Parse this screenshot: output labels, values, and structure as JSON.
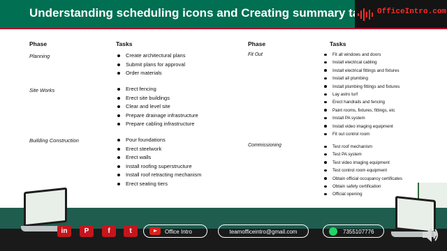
{
  "header": {
    "title": "Understanding scheduling icons and Creating summary task",
    "logo_text": "OfficeIntro.com"
  },
  "left_table": {
    "phase_header": "Phase",
    "tasks_header": "Tasks",
    "rows": [
      {
        "phase": "Planning",
        "tasks": [
          "Create architectural plans",
          "Submit plans for approval",
          "Order materials"
        ]
      },
      {
        "phase": "Site Works",
        "tasks": [
          "Erect fencing",
          "Erect site buildings",
          "Clear and level site",
          "Prepare drainage infrastructure",
          "Prepare cabling infrastructure"
        ]
      },
      {
        "phase": "Building Construction",
        "tasks": [
          "Pour foundations",
          "Erect steelwork",
          "Erect walls",
          "Install roofing superstructure",
          "Install roof retracting mechanism",
          "Erect seating tiers"
        ]
      }
    ]
  },
  "right_table": {
    "phase_header": "Phase",
    "tasks_header": "Tasks",
    "rows": [
      {
        "phase": "Fit Out",
        "tasks": [
          "Fit all windows and doors",
          "Install electrical cabling",
          "Install electrical fittings and fixtures",
          "Install all plumbing",
          "Install plumbing fittings and fixtures",
          "Lay astro turf",
          "Erect handrails and fencing",
          "Paint rooms, fixtures, fittings, etc",
          "Install PA system",
          "Install video imaging equipment",
          "Fit out control room"
        ]
      },
      {
        "phase": "Commissioning",
        "tasks": [
          "Test roof mechanism",
          "Test PA system",
          "Test video imaging equipment",
          "Test control room equipment",
          "Obtain official occupancy certificates",
          "Obtain safety certification",
          "Official opening"
        ]
      }
    ]
  },
  "footer": {
    "social_icons": [
      "linkedin-icon",
      "pinterest-icon",
      "facebook-icon",
      "twitter-icon"
    ],
    "youtube_label": "Office Intro",
    "email": "teamofficeintro@gmail.com",
    "whatsapp": "7355107776"
  },
  "side_tag": "oject",
  "colors": {
    "header_bg": "#006f52",
    "accent_red": "#c4161c",
    "footer_band": "#1f5d4f"
  }
}
